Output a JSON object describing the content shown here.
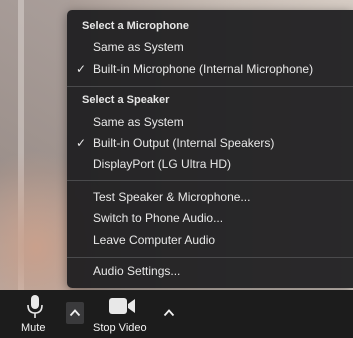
{
  "menu": {
    "microphone_header": "Select a Microphone",
    "microphone_items": [
      {
        "label": "Same as System",
        "checked": false
      },
      {
        "label": "Built-in Microphone (Internal Microphone)",
        "checked": true
      }
    ],
    "speaker_header": "Select a Speaker",
    "speaker_items": [
      {
        "label": "Same as System",
        "checked": false
      },
      {
        "label": "Built-in Output (Internal Speakers)",
        "checked": true
      },
      {
        "label": "DisplayPort (LG Ultra HD)",
        "checked": false
      }
    ],
    "actions": [
      "Test Speaker & Microphone...",
      "Switch to Phone Audio...",
      "Leave Computer Audio"
    ],
    "settings": "Audio Settings...",
    "check_glyph": "✓"
  },
  "toolbar": {
    "mute_label": "Mute",
    "stop_video_label": "Stop Video",
    "mic_icon": "microphone-icon",
    "video_icon": "video-camera-icon",
    "caret_icon": "chevron-up-icon"
  },
  "colors": {
    "menu_bg": "#1c1c1e",
    "toolbar_bg": "#1c1c1c",
    "text": "#e8e8e8"
  }
}
